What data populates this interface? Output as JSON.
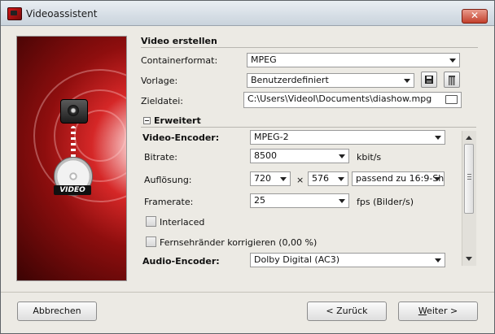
{
  "window": {
    "title": "Videoassistent"
  },
  "banner": {
    "video_label": "VIDEO"
  },
  "section": {
    "title": "Video erstellen"
  },
  "fields": {
    "container_label": "Containerformat:",
    "container_value": "MPEG",
    "vorlage_label": "Vorlage:",
    "vorlage_value": "Benutzerdefiniert",
    "zieldatei_label": "Zieldatei:",
    "zieldatei_value": "C:\\Users\\VideoI\\Documents\\diashow.mpg"
  },
  "advanced": {
    "title": "Erweitert",
    "video_encoder_label": "Video-Encoder:",
    "video_encoder_value": "MPEG-2",
    "bitrate_label": "Bitrate:",
    "bitrate_value": "8500",
    "bitrate_unit": "kbit/s",
    "resolution_label": "Auflösung:",
    "res_width": "720",
    "res_times": "×",
    "res_height": "576",
    "aspect_value": "passend zu 16:9-Sh",
    "framerate_label": "Framerate:",
    "framerate_value": "25",
    "framerate_unit": "fps (Bilder/s)",
    "interlaced_label": "Interlaced",
    "overscan_label": "Fernsehränder korrigieren (0,00 %)",
    "audio_encoder_label": "Audio-Encoder:",
    "audio_encoder_value": "Dolby Digital (AC3)"
  },
  "buttons": {
    "cancel": "Abbrechen",
    "back": "< Zurück",
    "next_underlined": "W",
    "next_rest": "eiter >"
  },
  "icons": [
    "app-icon",
    "close-icon",
    "camera-icon",
    "disc-icon",
    "save-icon",
    "trash-icon",
    "folder-icon",
    "collapse-icon",
    "dropdown-arrow-icon",
    "scroll-up-icon",
    "scroll-down-icon"
  ]
}
